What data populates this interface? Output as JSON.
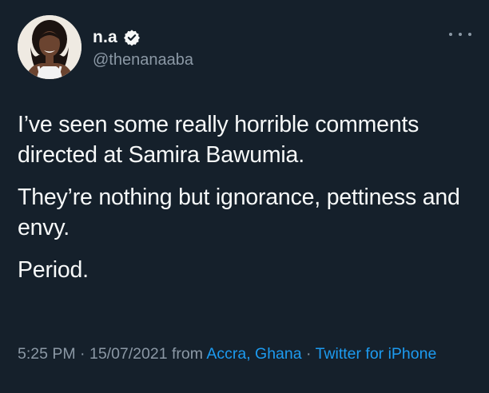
{
  "user": {
    "display_name": "n.a",
    "handle": "@thenanaaba",
    "verified_icon": "verified-badge-icon",
    "avatar_icon": "profile-avatar"
  },
  "menu": {
    "icon": "more-options-icon"
  },
  "tweet": {
    "paragraphs": [
      "I’ve seen some really horrible comments directed at Samira Bawumia.",
      "They’re nothing but ignorance, pettiness and envy.",
      "Period."
    ]
  },
  "meta": {
    "time": "5:25 PM",
    "separator_1": " · ",
    "date": "15/07/2021",
    "from_label": " from ",
    "location": "Accra, Ghana",
    "separator_2": " · ",
    "source": "Twitter for iPhone"
  },
  "colors": {
    "background": "#15202b",
    "text_primary": "#f7f9f9",
    "text_secondary": "#8b98a5",
    "link": "#1d9bf0"
  }
}
